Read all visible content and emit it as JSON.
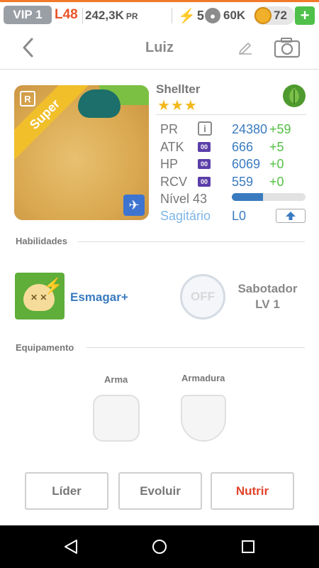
{
  "status_bar": {
    "vip": "VIP 1",
    "level": "L48",
    "power_value": "242,3K",
    "power_unit": "PR",
    "energy": "5",
    "paw_points": "60K",
    "coins": "72",
    "add": "+"
  },
  "header": {
    "title": "Luiz",
    "back_icon": "chevron-left-icon",
    "edit_icon": "pencil-icon",
    "camera_icon": "camera-icon"
  },
  "monster": {
    "rank_badge": "R",
    "ribbon": "Super",
    "species": "Shellter",
    "stars": "★★★",
    "stars_count": 3,
    "element_icon": "leaf-icon",
    "type_icon": "plane-icon",
    "stats": [
      {
        "label": "PR",
        "value": "24380",
        "bonus": "+59"
      },
      {
        "label": "ATK",
        "badge": "00",
        "value": "666",
        "bonus": "+5"
      },
      {
        "label": "HP",
        "badge": "00",
        "value": "6069",
        "bonus": "+0"
      },
      {
        "label": "RCV",
        "badge": "00",
        "value": "559",
        "bonus": "+0"
      }
    ],
    "level_label": "Nível 43",
    "xp_fraction": 0.42,
    "constellation": "Sagitário",
    "constellation_level": "L0"
  },
  "abilities": {
    "section_label": "Habilidades",
    "skill": "Esmagar+",
    "passive_state": "OFF",
    "passive_name": "Sabotador",
    "passive_level": "LV 1"
  },
  "equipment": {
    "section_label": "Equipamento",
    "weapon_label": "Arma",
    "armor_label": "Armadura"
  },
  "actions": {
    "leader": "Líder",
    "evolve": "Evoluir",
    "feed": "Nutrir"
  },
  "colors": {
    "accent_blue": "#3a7bc0",
    "bonus_green": "#55c045",
    "feed_red": "#e0442a",
    "vip_gray": "#9a9fa6"
  }
}
